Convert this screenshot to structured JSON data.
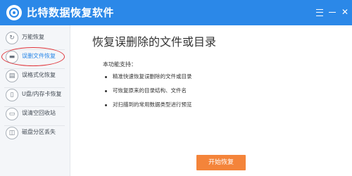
{
  "app": {
    "title": "比特数据恢复软件",
    "accent_color": "#2b88e8",
    "logo_icon": "disk-logo-icon",
    "window_buttons": [
      "menu-icon",
      "minimize-icon",
      "close-icon"
    ]
  },
  "sidebar": {
    "items": [
      {
        "label": "万能恢复",
        "icon": "refresh-icon"
      },
      {
        "label": "误删文件恢复",
        "icon": "folder-icon",
        "active": true
      },
      {
        "label": "误格式化恢复",
        "icon": "format-icon"
      },
      {
        "label": "U盘/内存卡恢复",
        "icon": "usb-icon"
      },
      {
        "label": "误清空回收站",
        "icon": "trash-icon"
      },
      {
        "label": "磁盘分区丢失",
        "icon": "disk-icon"
      }
    ],
    "active_color": "#2b88e8"
  },
  "main": {
    "title": "恢复误删除的文件或目录",
    "intro": "本功能支持：",
    "bullets": [
      "精准快速恢复误删除的文件或目录",
      "可恢复原来的目录结构、文件名",
      "对扫描到的常用数据类型进行预览"
    ],
    "start_button": "开始恢复",
    "start_button_color": "#f4843a"
  }
}
